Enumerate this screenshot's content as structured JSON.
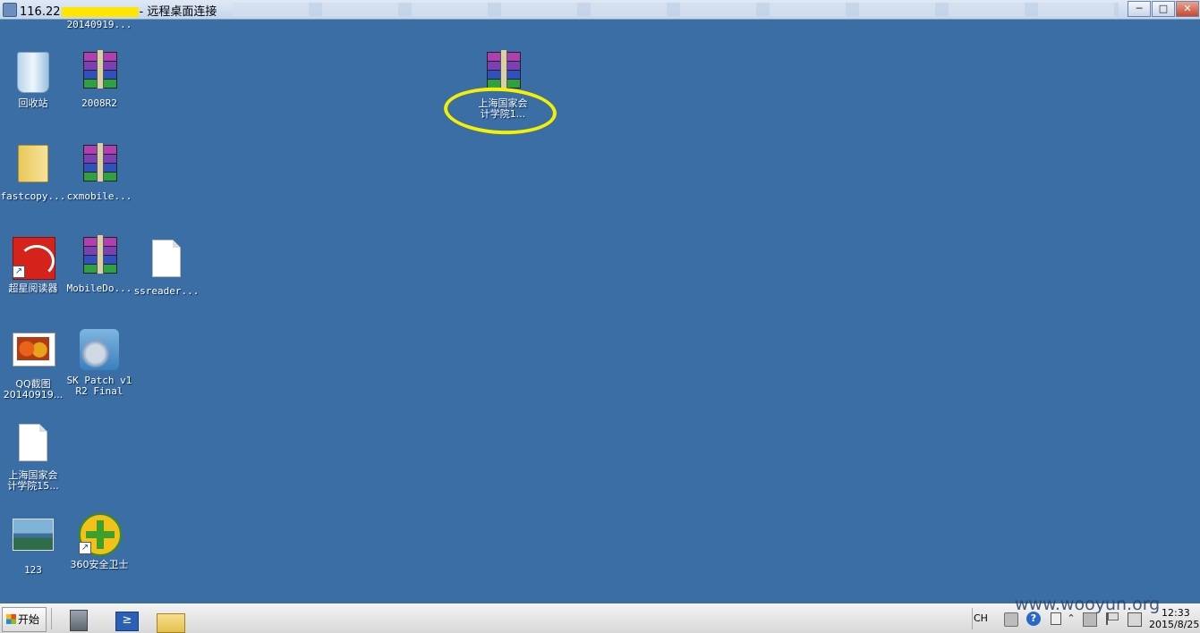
{
  "window": {
    "title_prefix": "116.22",
    "title_suffix": "- 远程桌面连接",
    "minimize_glyph": "─",
    "maximize_glyph": "□",
    "close_glyph": "✕"
  },
  "desktop": {
    "icons": [
      {
        "label": "20140919...",
        "icon": "qq-screenshot-icon"
      },
      {
        "label": "回收站",
        "icon": "recycle-bin-icon"
      },
      {
        "label": "2008R2",
        "icon": "rar-archive-icon"
      },
      {
        "label": "上海国家会\n计学院1...",
        "icon": "rar-archive-icon"
      },
      {
        "label": "fastcopy...",
        "icon": "folder-icon"
      },
      {
        "label": "cxmobile...",
        "icon": "rar-archive-icon"
      },
      {
        "label": "超星阅读器",
        "icon": "superstar-reader-icon"
      },
      {
        "label": "MobileDo...",
        "icon": "rar-archive-icon"
      },
      {
        "label": "ssreader...",
        "icon": "blank-file-icon"
      },
      {
        "label": "QQ截图\n20140919...",
        "icon": "qq-screenshot-icon"
      },
      {
        "label": "SK Patch v1\nR2 Final",
        "icon": "sk-patch-icon"
      },
      {
        "label": "上海国家会\n计学院15...",
        "icon": "blank-file-icon"
      },
      {
        "label": "123",
        "icon": "landscape-image-icon"
      },
      {
        "label": "360安全卫士",
        "icon": "360-security-icon"
      }
    ]
  },
  "taskbar": {
    "start_label": "开始",
    "lang": "CH",
    "help_glyph": "?",
    "up_glyph": "⌃",
    "ps_glyph": "≥",
    "clock_time": "12:33",
    "clock_date": "2015/8/25"
  },
  "watermark": "www.wooyun.org",
  "colors": {
    "desktop_bg": "#3a6ea5",
    "highlight": "#f5f000",
    "redaction": "#ffe600"
  }
}
